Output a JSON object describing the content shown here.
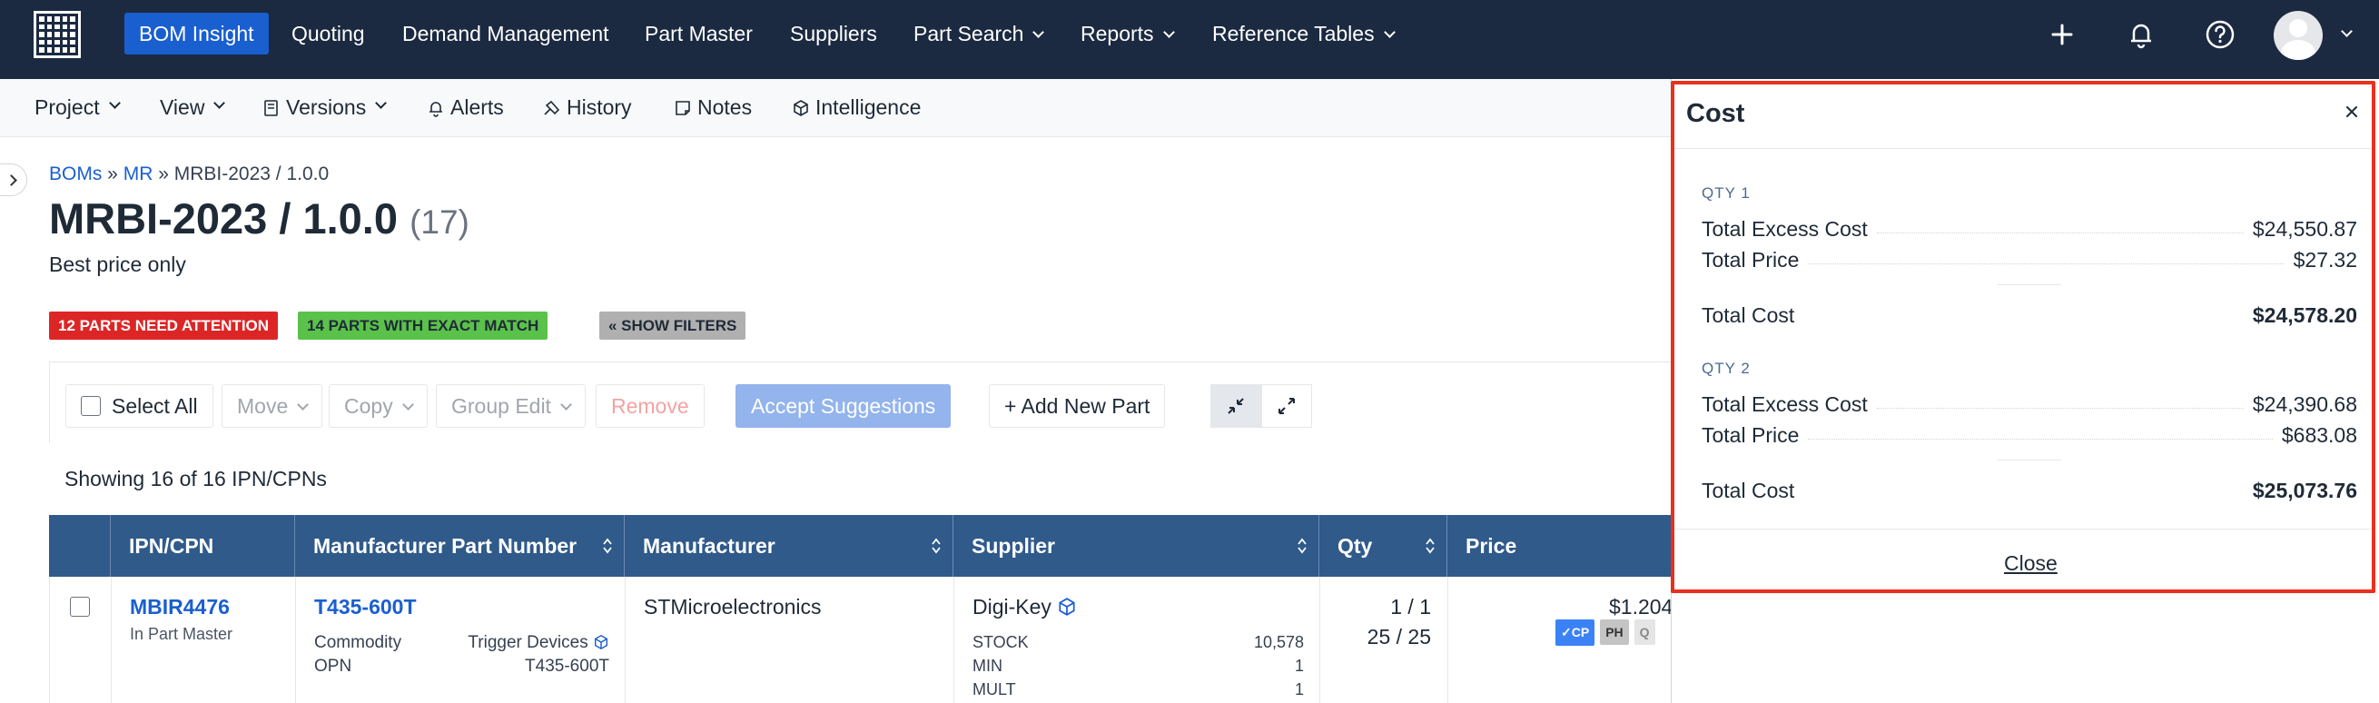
{
  "topnav": {
    "items": [
      "BOM Insight",
      "Quoting",
      "Demand Management",
      "Part Master",
      "Suppliers",
      "Part Search",
      "Reports",
      "Reference Tables"
    ]
  },
  "subnav": {
    "project": "Project",
    "view": "View",
    "versions": "Versions",
    "alerts": "Alerts",
    "history": "History",
    "notes": "Notes",
    "intelligence": "Intelligence"
  },
  "breadcrumb": {
    "boms": "BOMs",
    "sep1": " » ",
    "mr": "MR",
    "sep2": " » ",
    "current": "MRBI-2023 / 1.0.0"
  },
  "page": {
    "title": "MRBI-2023 / 1.0.0",
    "count": "(17)",
    "subtitle": "Best price only"
  },
  "badges": {
    "attention": "12 PARTS NEED ATTENTION",
    "exact": "14 PARTS WITH EXACT MATCH",
    "filters": "« SHOW FILTERS"
  },
  "toolbar": {
    "select_all": "Select All",
    "move": "Move",
    "copy": "Copy",
    "group_edit": "Group Edit",
    "remove": "Remove",
    "accept": "Accept Suggestions",
    "add_new": "+ Add New Part"
  },
  "showing": "Showing 16 of 16 IPN/CPNs",
  "table": {
    "headers": [
      "IPN/CPN",
      "Manufacturer Part Number",
      "Manufacturer",
      "Supplier",
      "Qty",
      "Price"
    ],
    "row": {
      "ipn": "MBIR4476",
      "ipn_sub": "In Part Master",
      "mpn": "T435-600T",
      "commodity_label": "Commodity",
      "commodity_value": "Trigger Devices",
      "opn_label": "OPN",
      "opn_value": "T435-600T",
      "manufacturer": "STMicroelectronics",
      "supplier": "Digi-Key",
      "stock_label": "STOCK",
      "stock_value": "10,578",
      "min_label": "MIN",
      "min_value": "1",
      "mult_label": "MULT",
      "mult_value": "1",
      "qty1": "1 / 1",
      "qty2": "25 / 25",
      "price": "$1.204",
      "pill_cp": "✓CP",
      "pill_ph": "PH",
      "pill_q": "Q"
    }
  },
  "cost_panel": {
    "title": "Cost",
    "qty1_label": "QTY 1",
    "qty1": {
      "excess_label": "Total Excess Cost",
      "excess_value": "$24,550.87",
      "price_label": "Total Price",
      "price_value": "$27.32",
      "total_label": "Total Cost",
      "total_value": "$24,578.20"
    },
    "qty2_label": "QTY 2",
    "qty2": {
      "excess_label": "Total Excess Cost",
      "excess_value": "$24,390.68",
      "price_label": "Total Price",
      "price_value": "$683.08",
      "total_label": "Total Cost",
      "total_value": "$25,073.76"
    },
    "close": "Close"
  },
  "colors": {
    "nav_bg": "#1b2a41",
    "accent": "#1a5fd0",
    "table_header": "#2f5a8a",
    "highlight_border": "#e8311f"
  },
  "icons": [
    "grid-logo-icon",
    "plus-icon",
    "bell-icon",
    "help-icon",
    "user-icon",
    "versions-icon",
    "alerts-icon",
    "history-icon",
    "notes-icon",
    "intelligence-icon",
    "collapse-icon",
    "expand-icon",
    "sort-icon",
    "cube-icon",
    "close-icon"
  ]
}
